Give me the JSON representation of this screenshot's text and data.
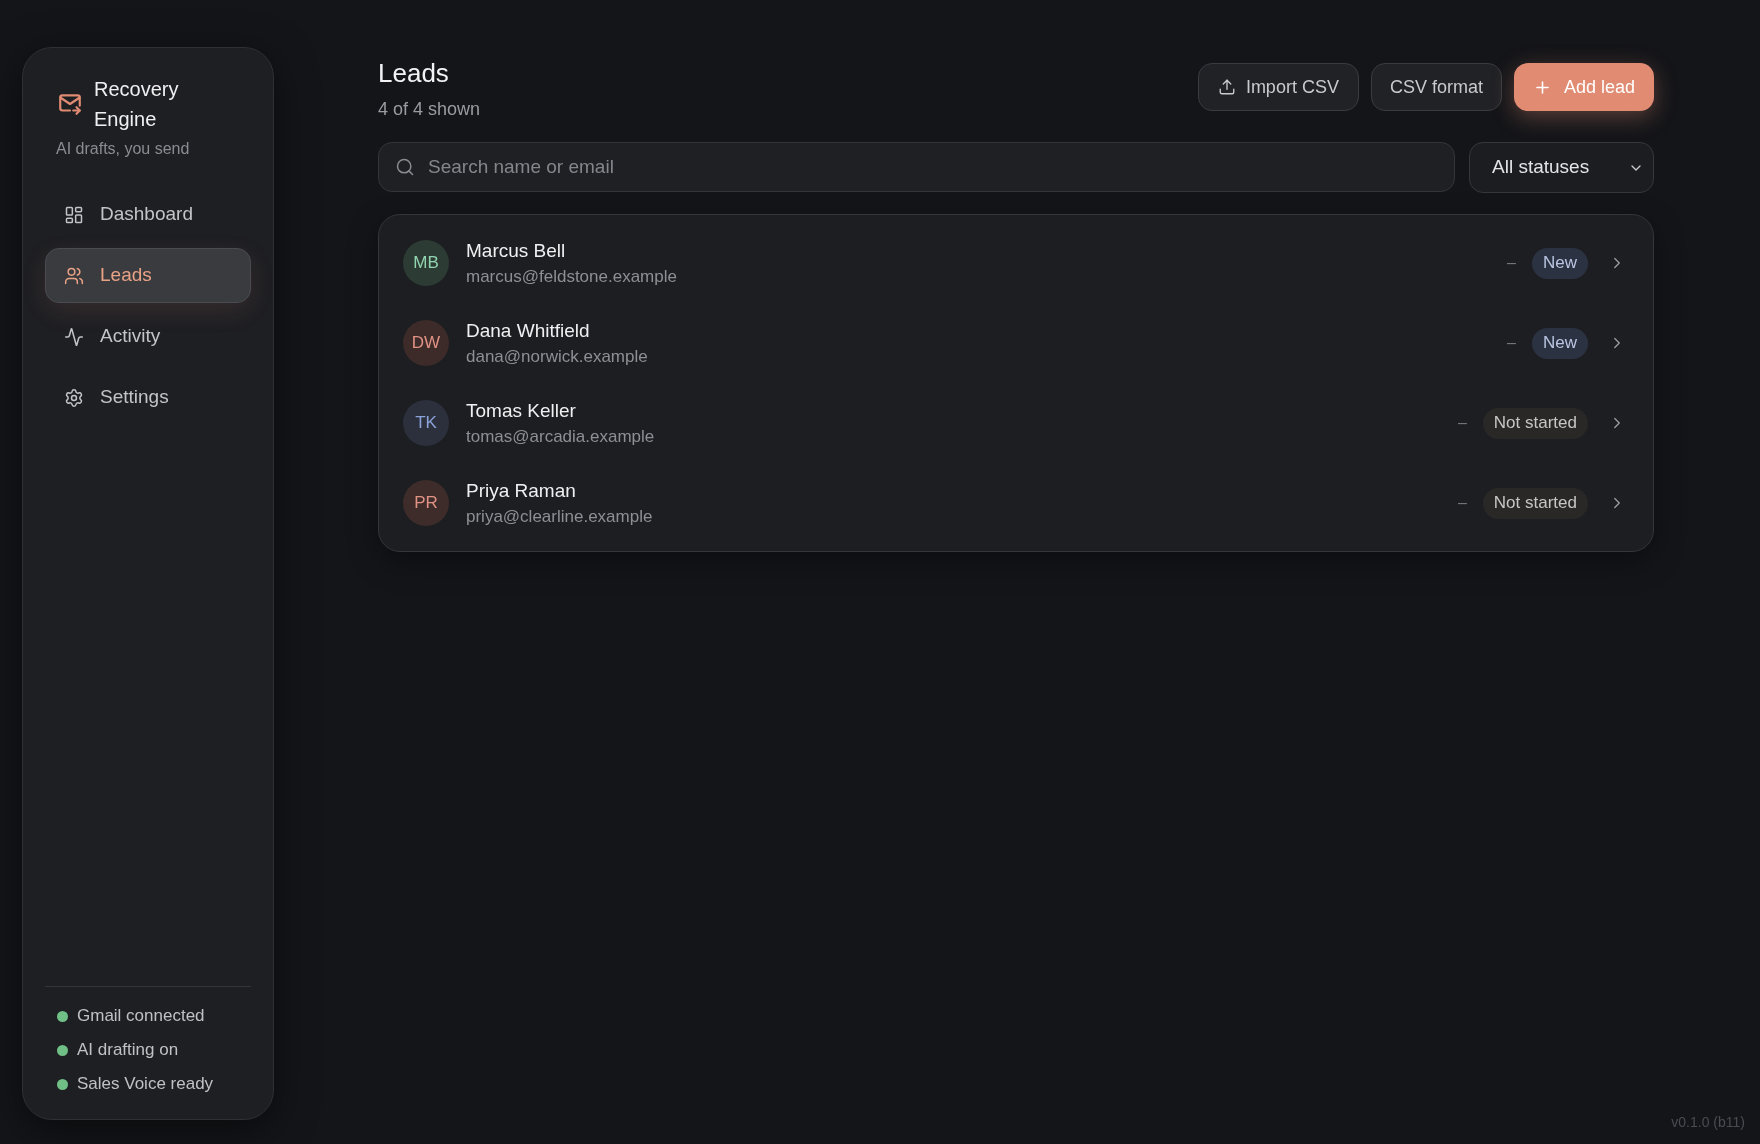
{
  "sidebar": {
    "brand": {
      "title": "Recovery Engine",
      "subtitle": "AI drafts, you send"
    },
    "nav": [
      {
        "label": "Dashboard",
        "selected": false
      },
      {
        "label": "Leads",
        "selected": true
      },
      {
        "label": "Activity",
        "selected": false
      },
      {
        "label": "Settings",
        "selected": false
      }
    ],
    "status": [
      {
        "label": "Gmail connected",
        "on": true
      },
      {
        "label": "AI drafting on",
        "on": true
      },
      {
        "label": "Sales Voice ready",
        "on": true
      }
    ]
  },
  "header": {
    "title": "Leads",
    "count": "4 of 4 shown"
  },
  "actions": [
    {
      "label": "Import CSV",
      "kind": "upload"
    },
    {
      "label": "CSV format",
      "kind": "plain"
    },
    {
      "label": "Add lead",
      "kind": "primary"
    }
  ],
  "search": {
    "placeholder": "Search name or email"
  },
  "filter": {
    "value": "All statuses"
  },
  "leads": [
    {
      "initials": "MB",
      "color": "#2c3b33",
      "name": "Marcus Bell",
      "email": "marcus@feldstone.example",
      "column_3": "–",
      "status": {
        "label": "New",
        "kind": "new"
      }
    },
    {
      "initials": "DW",
      "color": "#3c2b28",
      "name": "Dana Whitfield",
      "email": "dana@norwick.example",
      "column_3": "–",
      "status": {
        "label": "New",
        "kind": "new"
      }
    },
    {
      "initials": "TK",
      "color": "#2b303c",
      "name": "Tomas Keller",
      "email": "tomas@arcadia.example",
      "column_3": "–",
      "status": {
        "label": "Not started",
        "kind": "not_started"
      }
    },
    {
      "initials": "PR",
      "color": "#3d2c29",
      "name": "Priya Raman",
      "email": "priya@clearline.example",
      "column_3": "–",
      "status": {
        "label": "Not started",
        "kind": "not_started"
      }
    }
  ],
  "version": "v0.1.0 (b11)"
}
